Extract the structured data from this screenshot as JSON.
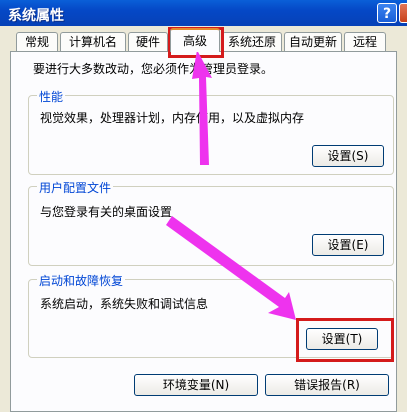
{
  "window": {
    "title": "系统属性",
    "help_glyph": "?"
  },
  "tabs": [
    {
      "label": "常规"
    },
    {
      "label": "计算机名"
    },
    {
      "label": "硬件"
    },
    {
      "label": "高级",
      "active": true
    },
    {
      "label": "系统还原"
    },
    {
      "label": "自动更新"
    },
    {
      "label": "远程"
    }
  ],
  "note": "要进行大多数改动，您必须作为管理员登录。",
  "groups": {
    "performance": {
      "title": "性能",
      "desc": "视觉效果，处理器计划，内存使用，以及虚拟内存",
      "button": "设置(S)"
    },
    "profiles": {
      "title": "用户配置文件",
      "desc": "与您登录有关的桌面设置",
      "button": "设置(E)"
    },
    "startup": {
      "title": "启动和故障恢复",
      "desc": "系统启动，系统失败和调试信息",
      "button": "设置(T)"
    }
  },
  "bottom_buttons": {
    "env": "环境变量(N)",
    "error": "错误报告(R)"
  },
  "colors": {
    "annotation_arrow": "#ee33ee",
    "annotation_box": "#d41b1b",
    "titlebar": "#0548c6"
  }
}
